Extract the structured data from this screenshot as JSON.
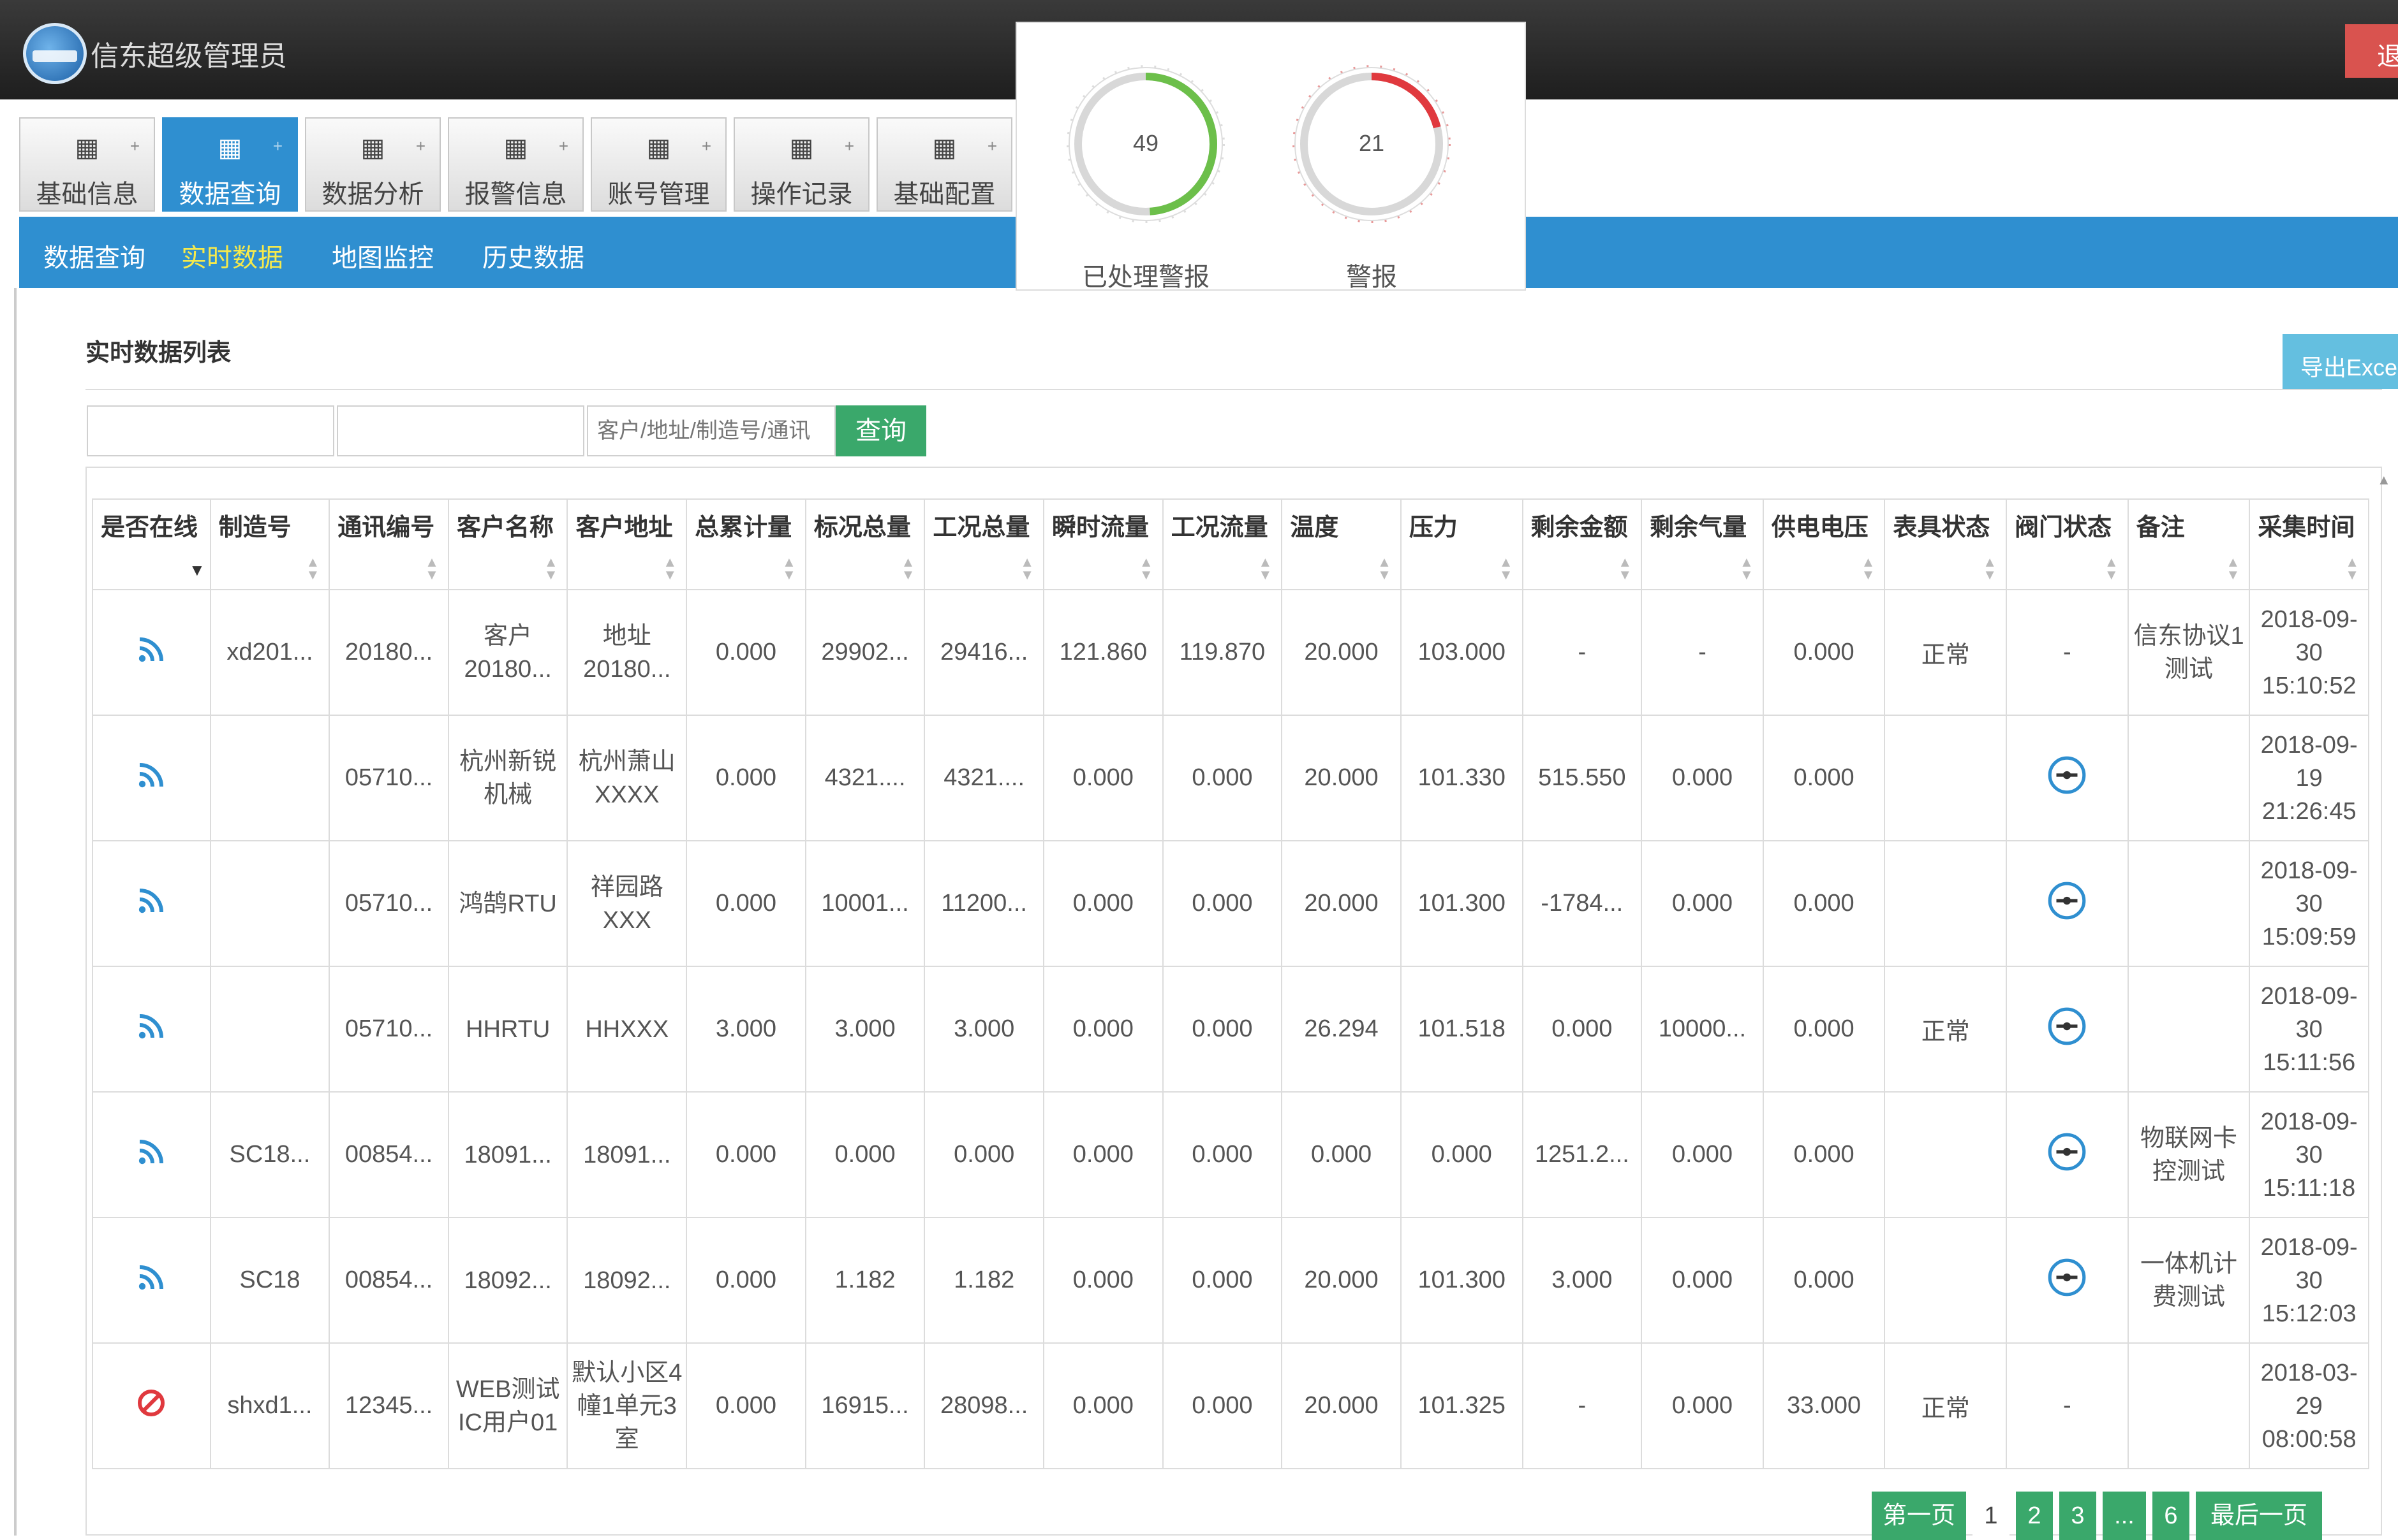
{
  "header": {
    "username": "信东超级管理员",
    "logout_label": "退"
  },
  "nav": {
    "tabs": [
      {
        "label": "基础信息",
        "icon": "grid-icon"
      },
      {
        "label": "数据查询",
        "icon": "grid-icon"
      },
      {
        "label": "数据分析",
        "icon": "grid-icon"
      },
      {
        "label": "报警信息",
        "icon": "grid-icon"
      },
      {
        "label": "账号管理",
        "icon": "grid-icon"
      },
      {
        "label": "操作记录",
        "icon": "grid-icon"
      },
      {
        "label": "基础配置",
        "icon": "grid-icon"
      }
    ],
    "active_tab": "数据查询",
    "subtabs": [
      {
        "label": "数据查询"
      },
      {
        "label": "实时数据"
      },
      {
        "label": "地图监控"
      },
      {
        "label": "历史数据"
      }
    ],
    "active_subtab": "实时数据"
  },
  "gauges": [
    {
      "value": "49",
      "label": "已处理警报",
      "color": "#6cbf4a"
    },
    {
      "value": "21",
      "label": "警报",
      "color": "#e0393e"
    }
  ],
  "section": {
    "title": "实时数据列表",
    "export_label": "导出Excel"
  },
  "search": {
    "field1_value": "",
    "field2_value": "",
    "placeholder": "客户/地址/制造号/通讯",
    "query_label": "查询"
  },
  "table": {
    "headers": [
      "是否在线",
      "制造号",
      "通讯编号",
      "客户名称",
      "客户地址",
      "总累计量",
      "标况总量",
      "工况总量",
      "瞬时流量",
      "工况流量",
      "温度",
      "压力",
      "剩余金额",
      "剩余气量",
      "供电电压",
      "表具状态",
      "阀门状态",
      "备注",
      "采集时间"
    ],
    "rows": [
      {
        "online": true,
        "cells": [
          "xd201...",
          "20180...",
          "客户 20180...",
          "地址 20180...",
          "0.000",
          "29902...",
          "29416...",
          "121.860",
          "119.870",
          "20.000",
          "103.000",
          "-",
          "-",
          "0.000",
          "正常",
          "-",
          "信东协议1测试",
          "2018-09-30 15:10:52"
        ],
        "valve_icon": false
      },
      {
        "online": true,
        "cells": [
          "",
          "05710...",
          "杭州新锐机械",
          "杭州萧山XXXX",
          "0.000",
          "4321....",
          "4321....",
          "0.000",
          "0.000",
          "20.000",
          "101.330",
          "515.550",
          "0.000",
          "0.000",
          "",
          "",
          "",
          "2018-09-19 21:26:45"
        ],
        "valve_icon": true
      },
      {
        "online": true,
        "cells": [
          "",
          "05710...",
          "鸿鹄RTU",
          "祥园路XXX",
          "0.000",
          "10001...",
          "11200...",
          "0.000",
          "0.000",
          "20.000",
          "101.300",
          "-1784...",
          "0.000",
          "0.000",
          "",
          "",
          "",
          "2018-09-30 15:09:59"
        ],
        "valve_icon": true
      },
      {
        "online": true,
        "cells": [
          "",
          "05710...",
          "HHRTU",
          "HHXXX",
          "3.000",
          "3.000",
          "3.000",
          "0.000",
          "0.000",
          "26.294",
          "101.518",
          "0.000",
          "10000...",
          "0.000",
          "正常",
          "",
          "",
          "2018-09-30 15:11:56"
        ],
        "valve_icon": true
      },
      {
        "online": true,
        "cells": [
          "SC18...",
          "00854...",
          "18091...",
          "18091...",
          "0.000",
          "0.000",
          "0.000",
          "0.000",
          "0.000",
          "0.000",
          "0.000",
          "1251.2...",
          "0.000",
          "0.000",
          "",
          "",
          "物联网卡控测试",
          "2018-09-30 15:11:18"
        ],
        "valve_icon": true
      },
      {
        "online": true,
        "cells": [
          "SC18",
          "00854...",
          "18092...",
          "18092...",
          "0.000",
          "1.182",
          "1.182",
          "0.000",
          "0.000",
          "20.000",
          "101.300",
          "3.000",
          "0.000",
          "0.000",
          "",
          "",
          "一体机计费测试",
          "2018-09-30 15:12:03"
        ],
        "valve_icon": true
      },
      {
        "online": false,
        "cells": [
          "shxd1...",
          "12345...",
          "WEB测试IC用户01",
          "默认小区4幢1单元3室",
          "0.000",
          "16915...",
          "28098...",
          "0.000",
          "0.000",
          "20.000",
          "101.325",
          "-",
          "0.000",
          "33.000",
          "正常",
          "-",
          "",
          "2018-03-29 08:00:58"
        ],
        "valve_icon": false
      }
    ]
  },
  "pagination": {
    "first_label": "第一页",
    "pages": [
      "1",
      "2",
      "3",
      "...",
      "6"
    ],
    "current": "1",
    "last_label": "最后一页"
  },
  "colors": {
    "accent": "#2f8fd0",
    "button_green": "#3aa86b",
    "online_icon": "#2f8fd0",
    "offline_icon": "#e0393e"
  }
}
